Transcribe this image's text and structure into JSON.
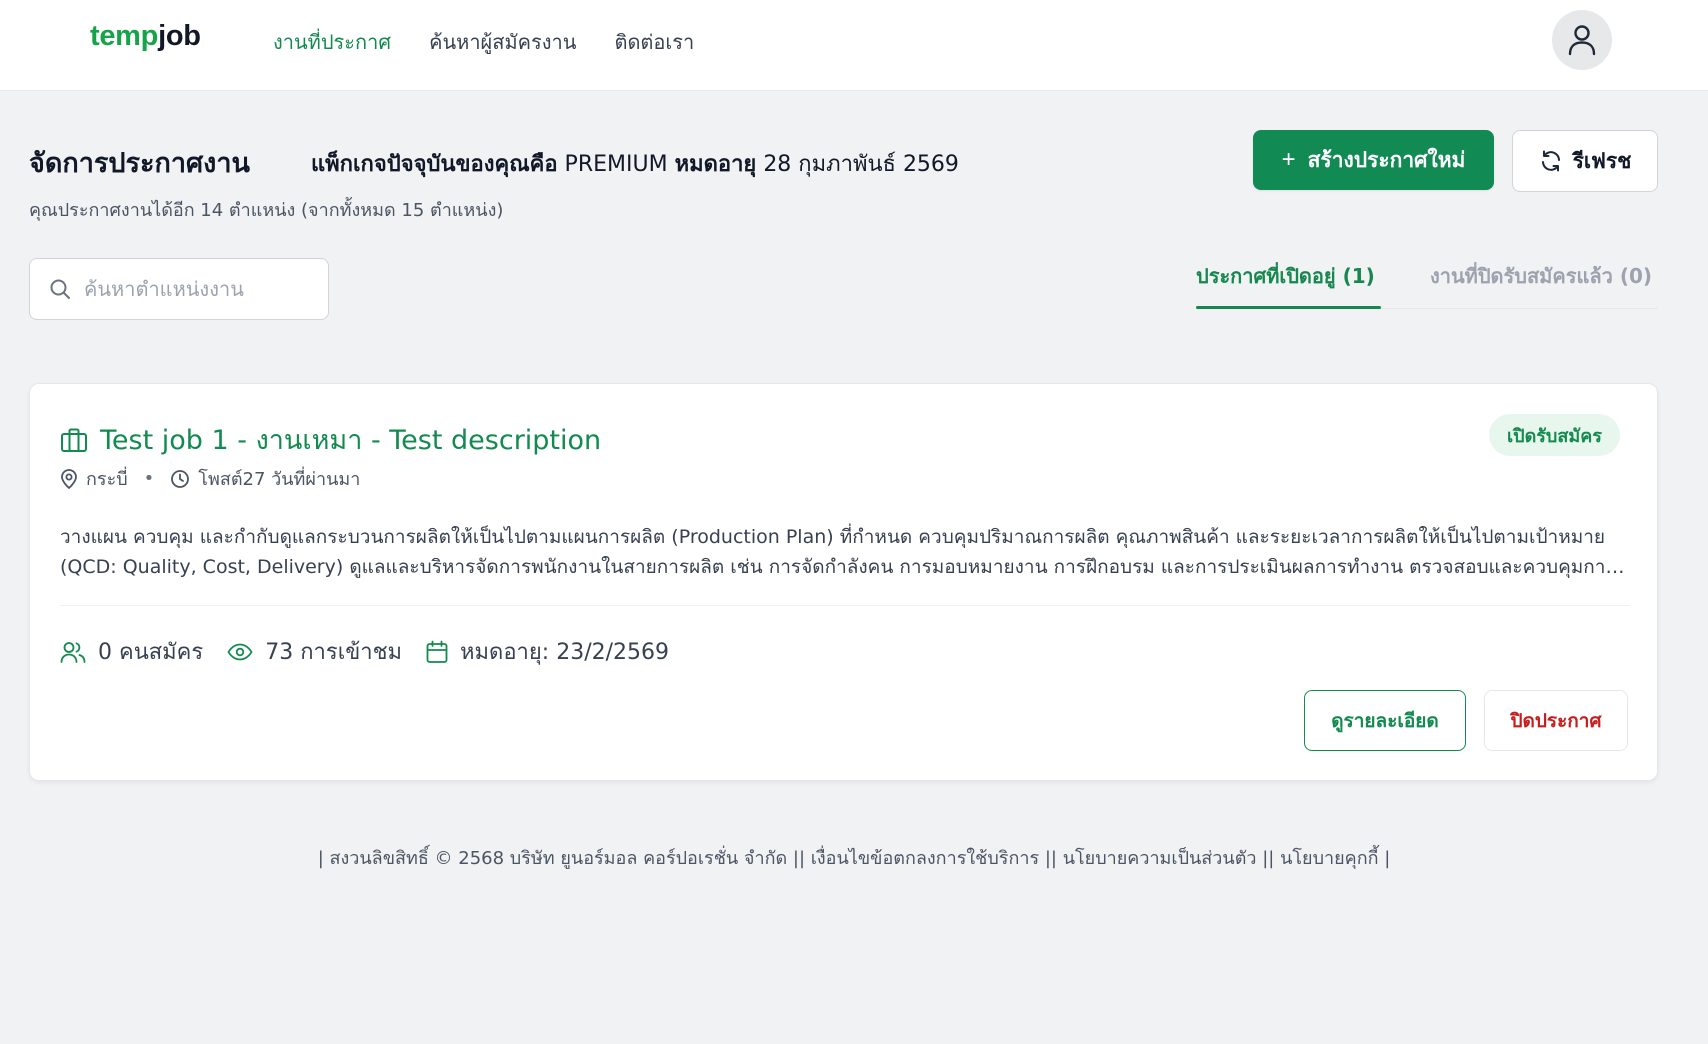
{
  "navbar": {
    "logo_part1": "temp",
    "logo_part2": "job",
    "links": [
      {
        "label": "งานที่ประกาศ",
        "active": true
      },
      {
        "label": "ค้นหาผู้สมัครงาน",
        "active": false
      },
      {
        "label": "ติดต่อเรา",
        "active": false
      }
    ],
    "avatar_icon": "user-icon"
  },
  "header": {
    "title": "จัดการประกาศงาน",
    "package_label": "แพ็กเกจปัจจุบันของคุณคือ",
    "package_name": "PREMIUM",
    "expiry_label": "หมดอายุ",
    "expiry_date": "28 กุมภาพันธ์ 2569",
    "subtitle": "คุณประกาศงานได้อีก 14 ตำแหน่ง (จากทั้งหมด 15 ตำแหน่ง)",
    "create_button": "สร้างประกาศใหม่",
    "create_icon": "+",
    "refresh_button": "รีเฟรช"
  },
  "search": {
    "placeholder": "ค้นหาตำแหน่งงาน",
    "value": ""
  },
  "tabs": [
    {
      "label": "ประกาศที่เปิดอยู่ (1)",
      "active": true
    },
    {
      "label": "งานที่ปิดรับสมัครแล้ว (0)",
      "active": false
    }
  ],
  "jobs": [
    {
      "title": "Test job 1 - งานเหมา - Test description",
      "status": "เปิดรับสมัคร",
      "location": "กระบี่",
      "posted": "โพสต์27 วันที่ผ่านมา",
      "description": "วางแผน ควบคุม และกำกับดูแลกระบวนการผลิตให้เป็นไปตามแผนการผลิต (Production Plan) ที่กำหนด ควบคุมปริมาณการผลิต คุณภาพสินค้า และระยะเวลาการผลิตให้เป็นไปตามเป้าหมาย (QCD: Quality, Cost, Delivery) ดูแลและบริหารจัดการพนักงานในสายการผลิต เช่น การจัดกำลังคน การมอบหมายงาน การฝึกอบรม และการประเมินผลการทำงาน ตรวจสอบและควบคุมการใช้วัตถุดิบ",
      "applicants": "0 คนสมัคร",
      "views": "73 การเข้าชม",
      "expiry": "หมดอายุ: 23/2/2569",
      "detail_button": "ดูรายละเอียด",
      "close_button": "ปิดประกาศ"
    }
  ],
  "footer": {
    "text": "| สงวนลิขสิทธิ์ © 2568 บริษัท ยูนอร์มอล คอร์ปอเรชั่น จำกัด || เงื่อนไขข้อตกลงการใช้บริการ || นโยบายความเป็นส่วนตัว || นโยบายคุกกี้ |"
  },
  "colors": {
    "brand_green": "#138a50",
    "logo_green": "#16a34a",
    "danger_red": "#c81e1e",
    "badge_bg": "#e8f7ee",
    "page_bg": "#f1f2f4"
  }
}
